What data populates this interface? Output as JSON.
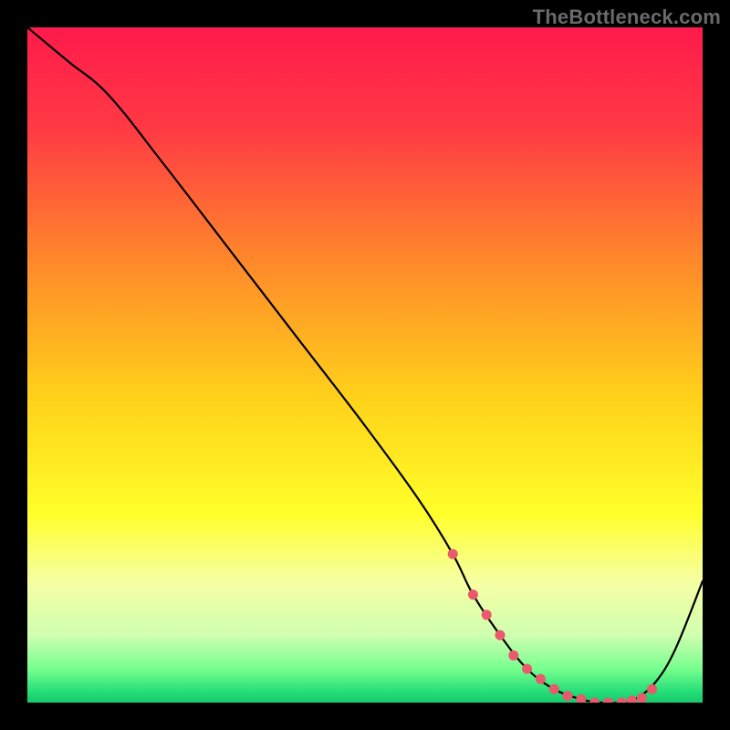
{
  "watermark": "TheBottleneck.com",
  "chart_data": {
    "type": "line",
    "title": "",
    "xlabel": "",
    "ylabel": "",
    "xlim": [
      0,
      100
    ],
    "ylim": [
      0,
      100
    ],
    "grid": false,
    "legend": false,
    "gradient_stops": [
      {
        "offset": 0.0,
        "color": "#ff1a4b"
      },
      {
        "offset": 0.15,
        "color": "#ff3a44"
      },
      {
        "offset": 0.35,
        "color": "#ff8a2a"
      },
      {
        "offset": 0.55,
        "color": "#ffd21a"
      },
      {
        "offset": 0.72,
        "color": "#ffff2a"
      },
      {
        "offset": 0.82,
        "color": "#f6ffa2"
      },
      {
        "offset": 0.9,
        "color": "#d0ffb0"
      },
      {
        "offset": 0.95,
        "color": "#77ff8e"
      },
      {
        "offset": 0.985,
        "color": "#22dd77"
      },
      {
        "offset": 1.0,
        "color": "#18c86a"
      }
    ],
    "series": [
      {
        "name": "bottleneck-curve",
        "color": "#000000",
        "width": 2.2,
        "x": [
          0,
          6,
          12,
          20,
          30,
          40,
          50,
          58,
          63,
          66,
          70,
          74,
          78,
          82,
          85,
          88,
          90,
          93,
          96,
          100
        ],
        "values": [
          100,
          95,
          90,
          80,
          67,
          54,
          41,
          30,
          22,
          16,
          10,
          5,
          2,
          0.5,
          0,
          0,
          0.5,
          3,
          8,
          18
        ]
      }
    ],
    "markers": {
      "name": "optimal-range-dots",
      "color": "#e85a6c",
      "radius": 5.5,
      "x": [
        63,
        66,
        68,
        70,
        72,
        74,
        76,
        78,
        80,
        82,
        84,
        86,
        88,
        89.5,
        91,
        92.5
      ],
      "values": [
        22,
        16,
        13,
        10,
        7,
        5,
        3.5,
        2,
        1,
        0.5,
        0,
        0,
        0,
        0.3,
        0.7,
        2
      ]
    }
  }
}
